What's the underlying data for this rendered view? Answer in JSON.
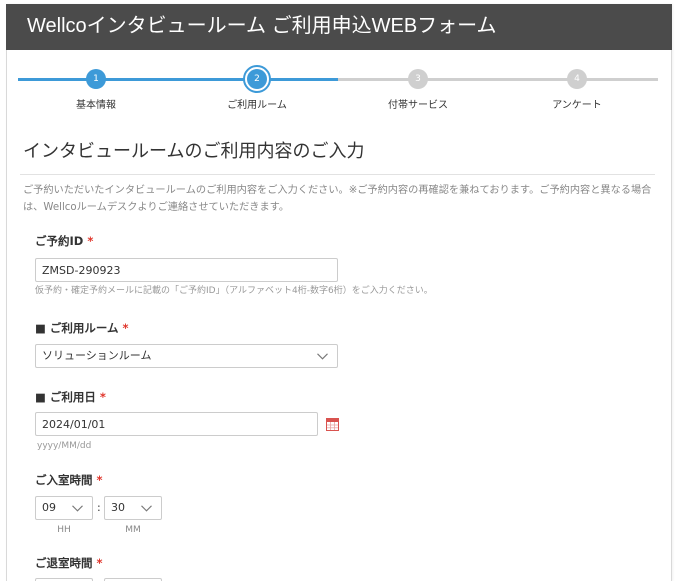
{
  "header": {
    "title": "Wellcoインタビュールーム ご利用申込WEBフォーム"
  },
  "progress": {
    "current_step": 2
  },
  "steps": [
    {
      "number": "1",
      "label": "基本情報"
    },
    {
      "number": "2",
      "label": "ご利用ルーム"
    },
    {
      "number": "3",
      "label": "付帯サービス"
    },
    {
      "number": "4",
      "label": "アンケート"
    }
  ],
  "section": {
    "title": "インタビュールームのご利用内容のご入力",
    "description": "ご予約いただいたインタビュールームのご利用内容をご入力ください。※ご予約内容の再確認を兼ねております。ご予約内容と異なる場合は、Wellcoルームデスクよりご連絡させていただきます。"
  },
  "fields": {
    "reservation_id": {
      "label": "ご予約ID",
      "required": "*",
      "value": "ZMSD-290923",
      "help": "仮予約・確定予約メールに記載の「ご予約ID」（アルファベット4桁-数字6桁）をご入力ください。"
    },
    "room": {
      "label": "■ ご利用ルーム",
      "required": "*",
      "value": "ソリューションルーム"
    },
    "date": {
      "label": "■ ご利用日",
      "required": "*",
      "value": "2024/01/01",
      "help": "yyyy/MM/dd"
    },
    "entry_time": {
      "label": "ご入室時間",
      "required": "*",
      "hour": "09",
      "separator": ":",
      "minute": "30",
      "hour_unit": "HH",
      "minute_unit": "MM"
    },
    "exit_time": {
      "label": "ご退室時間",
      "required": "*"
    }
  },
  "icons": {
    "select_arrow": "chevron-down-icon",
    "date_picker": "calendar-icon"
  },
  "colors": {
    "header_background": "#4b4b4b",
    "accent": "#3d9ad8",
    "inactive": "#cfcfcf",
    "required": "#e0352b"
  }
}
